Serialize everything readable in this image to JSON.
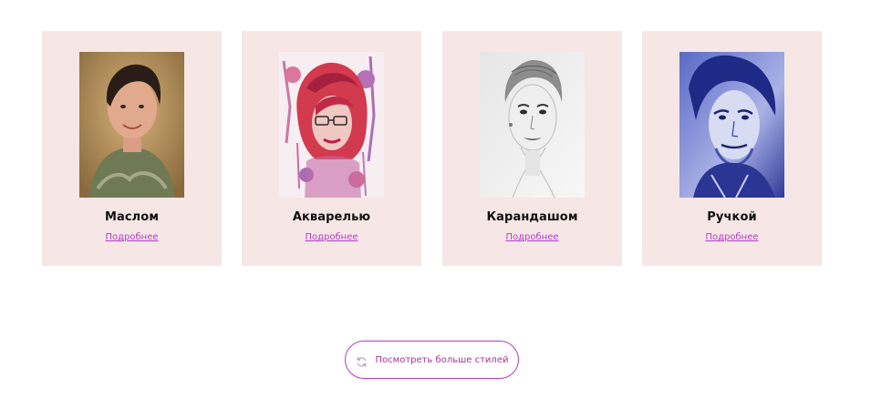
{
  "cards": [
    {
      "title": "Маслом",
      "link": "Подробнее"
    },
    {
      "title": "Акварелью",
      "link": "Подробнее"
    },
    {
      "title": "Карандашом",
      "link": "Подробнее"
    },
    {
      "title": "Ручкой",
      "link": "Подробнее"
    }
  ],
  "more_button": {
    "label": "Посмотреть больше стилей",
    "icon": "refresh-icon"
  },
  "colors": {
    "card_background": "#f6e6e6",
    "accent": "#b03cc4",
    "title_text": "#111111"
  }
}
